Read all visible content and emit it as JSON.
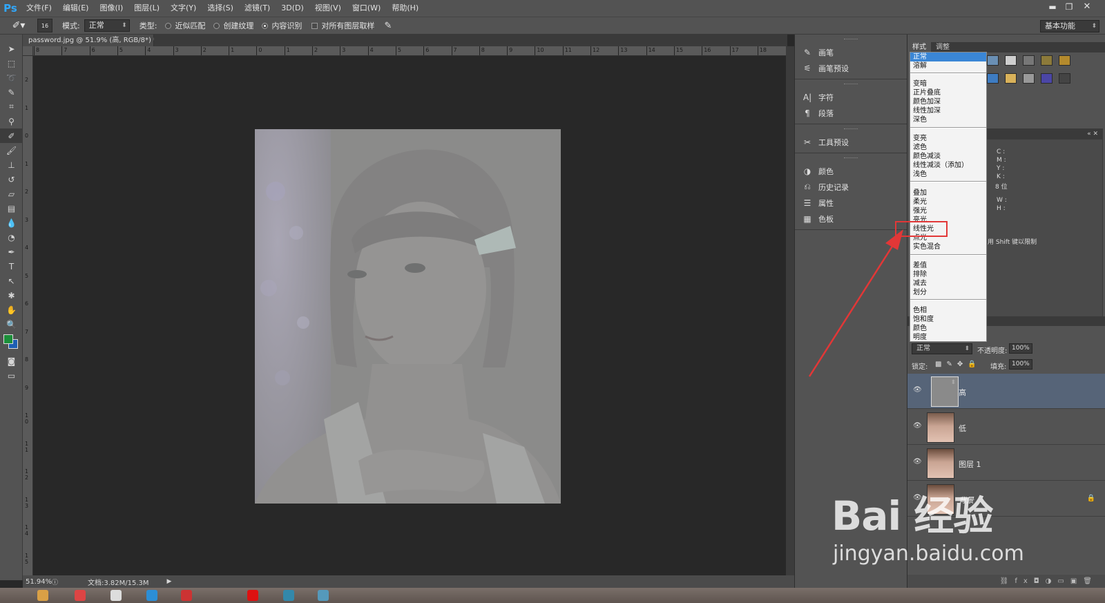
{
  "app": {
    "logo": "Ps"
  },
  "menu": [
    "文件(F)",
    "编辑(E)",
    "图像(I)",
    "图层(L)",
    "文字(Y)",
    "选择(S)",
    "滤镜(T)",
    "3D(D)",
    "视图(V)",
    "窗口(W)",
    "帮助(H)"
  ],
  "options": {
    "brush_size": "16",
    "mode_label": "模式:",
    "mode_value": "正常",
    "type_label": "类型:",
    "radio_proximity": "近似匹配",
    "radio_texture": "创建纹理",
    "radio_content_aware": "内容识别",
    "sample_all_layers": "对所有图层取样",
    "workspace": "基本功能"
  },
  "document": {
    "tab_title": "password.jpg @ 51.9% (高, RGB/8*) *",
    "ruler_h": [
      "8",
      "7",
      "6",
      "5",
      "4",
      "3",
      "2",
      "1",
      "0",
      "1",
      "2",
      "3",
      "4",
      "5",
      "6",
      "7",
      "8",
      "9",
      "10",
      "11",
      "12",
      "13",
      "14",
      "15",
      "16",
      "17",
      "18"
    ],
    "ruler_v": [
      "2",
      "1",
      "0",
      "1",
      "2",
      "3",
      "4",
      "5",
      "6",
      "7",
      "8",
      "9",
      "1 0",
      "1 1",
      "1 2",
      "1 3",
      "1 4",
      "1 5"
    ]
  },
  "status": {
    "zoom": "51.94%",
    "doc_info": "文档:3.82M/15.3M"
  },
  "dock": {
    "groups": [
      [
        {
          "label": "画笔",
          "icon": "brush-icon",
          "glyph": "✎"
        },
        {
          "label": "画笔预设",
          "icon": "brush-preset-icon",
          "glyph": "⚟"
        }
      ],
      [
        {
          "label": "字符",
          "icon": "character-icon",
          "glyph": "A|"
        },
        {
          "label": "段落",
          "icon": "paragraph-icon",
          "glyph": "¶"
        }
      ],
      [
        {
          "label": "工具预设",
          "icon": "tool-preset-icon",
          "glyph": "✂"
        }
      ],
      [
        {
          "label": "颜色",
          "icon": "color-icon",
          "glyph": "◑"
        },
        {
          "label": "历史记录",
          "icon": "history-icon",
          "glyph": "⎌"
        },
        {
          "label": "属性",
          "icon": "properties-icon",
          "glyph": "☰"
        },
        {
          "label": "色板",
          "icon": "swatches-icon",
          "glyph": "▦"
        }
      ]
    ]
  },
  "right_panel": {
    "tabs": [
      "样式",
      "调整"
    ],
    "info": {
      "c": "C :",
      "m": "M :",
      "y": "Y :",
      "k": "K :",
      "bits": "8 位",
      "w": "W :",
      "h": "H :",
      "hint": "用 Shift 键以限制"
    }
  },
  "blend_menu": {
    "groups": [
      [
        "正常",
        "溶解"
      ],
      [
        "变暗",
        "正片叠底",
        "颜色加深",
        "线性加深",
        "深色"
      ],
      [
        "变亮",
        "滤色",
        "颜色减淡",
        "线性减淡（添加）",
        "浅色"
      ],
      [
        "叠加",
        "柔光",
        "强光",
        "亮光",
        "线性光",
        "点光",
        "实色混合"
      ],
      [
        "差值",
        "排除",
        "减去",
        "划分"
      ],
      [
        "色相",
        "饱和度",
        "颜色",
        "明度"
      ]
    ],
    "selected": "正常",
    "annotated": "线性光"
  },
  "layers": {
    "blend_mode": "正常",
    "opacity_label": "不透明度:",
    "opacity": "100%",
    "lock_label": "锁定:",
    "fill_label": "填充:",
    "fill": "100%",
    "items": [
      {
        "name": "高",
        "active": true
      },
      {
        "name": "低",
        "active": false
      },
      {
        "name": "图层 1",
        "active": false
      },
      {
        "name": "背景",
        "active": false
      }
    ]
  },
  "watermark": {
    "logo": "Bai 经验",
    "url": "jingyan.baidu.com"
  },
  "colors": {
    "foreground": "#1c8f3a",
    "background": "#1e5fb3",
    "accent_red": "#e23737",
    "menu_highlight": "#3a86d6"
  }
}
